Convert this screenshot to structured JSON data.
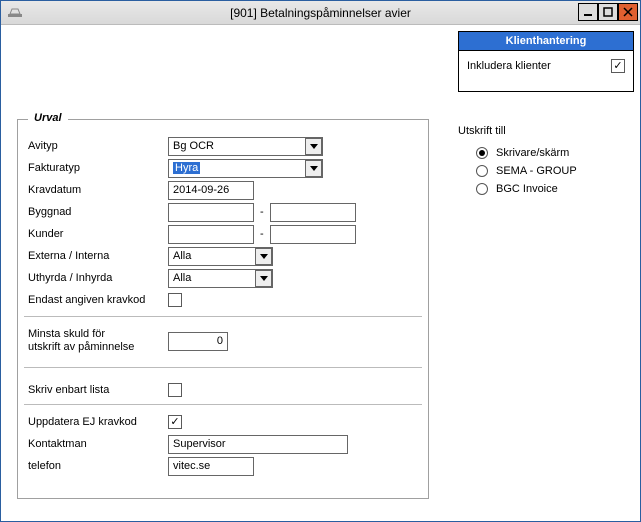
{
  "window": {
    "title": "[901]  Betalningspåminnelser avier"
  },
  "klient": {
    "header": "Klienthantering",
    "include_label": "Inkludera klienter",
    "include_checked": true
  },
  "urval": {
    "legend": "Urval",
    "avityp_label": "Avityp",
    "avityp_value": "Bg OCR",
    "fakturatyp_label": "Fakturatyp",
    "fakturatyp_value": "Hyra",
    "kravdatum_label": "Kravdatum",
    "kravdatum_value": "2014-09-26",
    "byggnad_label": "Byggnad",
    "byggnad_from": "",
    "byggnad_to": "",
    "kunder_label": "Kunder",
    "kunder_from": "",
    "kunder_to": "",
    "ext_int_label": "Externa / Interna",
    "ext_int_value": "Alla",
    "uthyrda_label": "Uthyrda / Inhyrda",
    "uthyrda_value": "Alla",
    "endast_label": "Endast angiven kravkod",
    "endast_checked": false,
    "minsta_label": "Minsta skuld för\nutskrift av påminnelse",
    "minsta_value": "0",
    "skriv_lista_label": "Skriv enbart lista",
    "skriv_lista_checked": false,
    "uppdatera_label": "Uppdatera EJ kravkod",
    "uppdatera_checked": true,
    "kontaktman_label": "Kontaktman",
    "kontaktman_value": "Supervisor",
    "telefon_label": "telefon",
    "telefon_value": "vitec.se"
  },
  "utskrift": {
    "title": "Utskrift till",
    "options": [
      {
        "label": "Skrivare/skärm",
        "checked": true
      },
      {
        "label": "SEMA - GROUP",
        "checked": false
      },
      {
        "label": "BGC Invoice",
        "checked": false
      }
    ]
  }
}
